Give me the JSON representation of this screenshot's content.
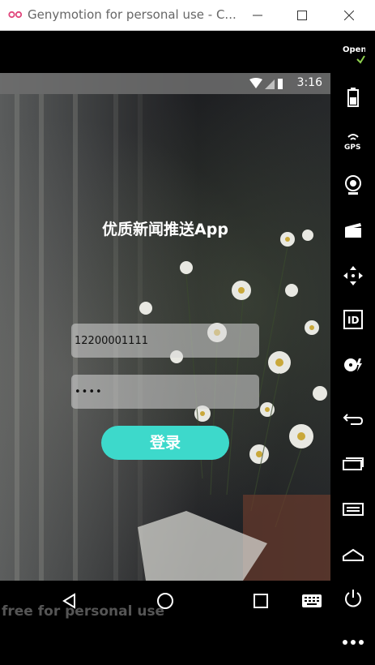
{
  "window": {
    "title": "Genymotion for personal use - C...",
    "minimize_icon": "minimize-icon",
    "maximize_icon": "maximize-icon",
    "close_icon": "close-icon"
  },
  "statusbar": {
    "time": "3:16",
    "icons": [
      "wifi-icon",
      "signal-icon",
      "battery-icon"
    ]
  },
  "app": {
    "title": "优质新闻推送App",
    "username_value": "12200001111",
    "password_value": "••••",
    "login_label": "登录",
    "accent_color": "#3dd9cb"
  },
  "navbar": {
    "buttons": [
      "back-icon",
      "home-icon",
      "recents-icon",
      "keyboard-icon"
    ]
  },
  "watermark": "free for personal use",
  "sidebar": {
    "opengapps_label": "Open GAPPS",
    "gps_label": "GPS",
    "id_label": "ID",
    "buttons": [
      "opengapps-icon",
      "battery-icon",
      "gps-icon",
      "webcam-icon",
      "capture-icon",
      "dpad-icon",
      "identifiers-icon",
      "media-icon",
      "back-icon",
      "recents-icon",
      "menu-icon",
      "home-icon",
      "power-icon",
      "more-icon"
    ]
  }
}
